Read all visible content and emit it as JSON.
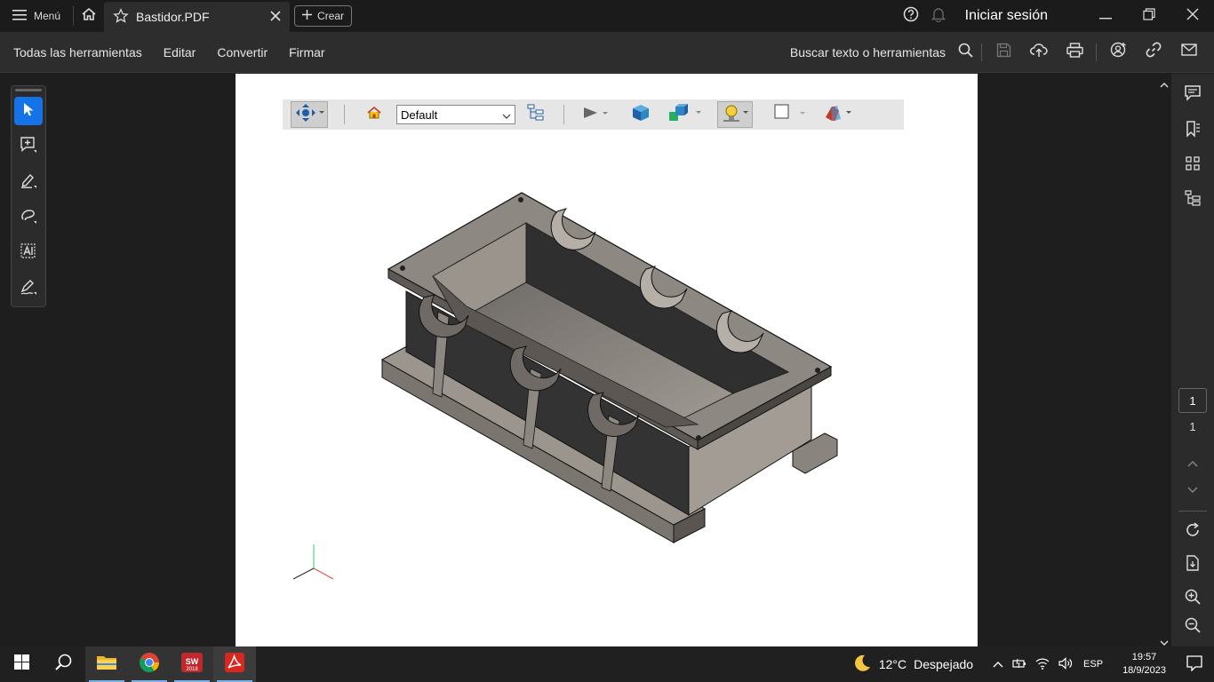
{
  "titlebar": {
    "menu_label": "Menú",
    "tab_title": "Bastidor.PDF",
    "create_label": "Crear",
    "signin_label": "Iniciar sesión"
  },
  "toolbar": {
    "items": [
      "Todas las herramientas",
      "Editar",
      "Convertir",
      "Firmar"
    ],
    "search_label": "Buscar texto o herramientas"
  },
  "model_toolbar": {
    "view_select": "Default"
  },
  "navigation": {
    "current_page": "1",
    "total_pages": "1"
  },
  "taskbar": {
    "weather_temp": "12°C",
    "weather_desc": "Despejado",
    "language": "ESP",
    "time": "19:57",
    "date": "18/9/2023"
  },
  "colors": {
    "accent": "#1473e6",
    "page_bg": "#ffffff",
    "model_face_light": "#8f8a84",
    "model_face_dark": "#3a3a3a"
  }
}
